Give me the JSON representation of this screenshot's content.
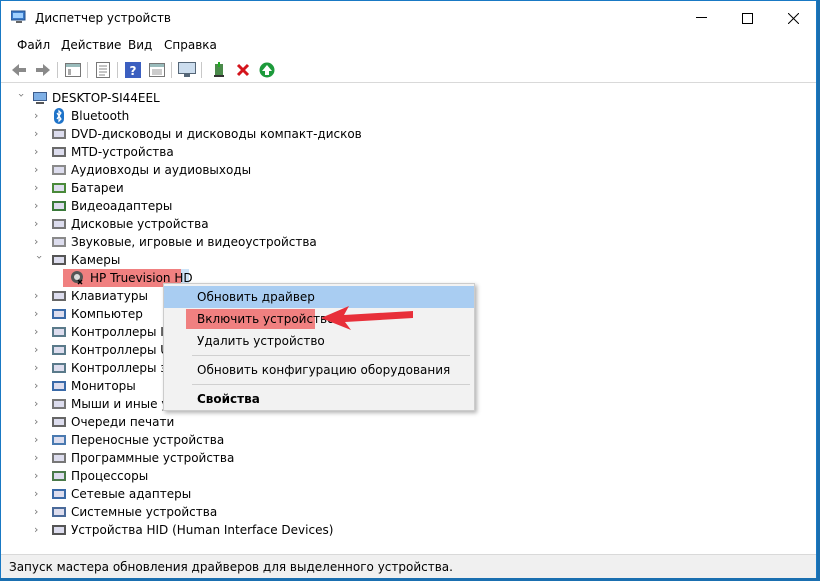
{
  "window": {
    "title": "Диспетчер устройств",
    "controls": {
      "minimize": "—",
      "maximize": "☐",
      "close": "✕"
    }
  },
  "menu": [
    "Файл",
    "Действие",
    "Вид",
    "Справка"
  ],
  "toolbar": {
    "buttons": [
      "back-icon",
      "forward-icon",
      "properties-pane-icon",
      "list-icon",
      "help-icon",
      "view-icon",
      "monitor-icon",
      "update-driver-icon",
      "uninstall-icon",
      "enable-device-icon"
    ]
  },
  "tree": {
    "root": "DESKTOP-SI44EEL",
    "categories": [
      "Bluetooth",
      "DVD-дисководы и дисководы компакт-дисков",
      "MTD-устройства",
      "Аудиовходы и аудиовыходы",
      "Батареи",
      "Видеоадаптеры",
      "Дисковые устройства",
      "Звуковые, игровые и видеоустройства",
      "Камеры",
      "Клавиатуры",
      "Компьютер",
      "Контроллеры ID",
      "Контроллеры US",
      "Контроллеры за",
      "Мониторы",
      "Мыши и иные у",
      "Очереди печати",
      "Переносные устройства",
      "Программные устройства",
      "Процессоры",
      "Сетевые адаптеры",
      "Системные устройства",
      "Устройства HID (Human Interface Devices)"
    ],
    "camera_child": "HP Truevision HD"
  },
  "context_menu": {
    "items": [
      "Обновить драйвер",
      "Включить устройство",
      "Удалить устройство",
      "Обновить конфигурацию оборудования",
      "Свойства"
    ]
  },
  "status": "Запуск мастера обновления драйверов для выделенного устройства.",
  "colors": {
    "accent": "#1979c4",
    "highlight": "#b7d7f5",
    "annotation_red": "#e8303a",
    "annotation_box": "#f08080"
  }
}
